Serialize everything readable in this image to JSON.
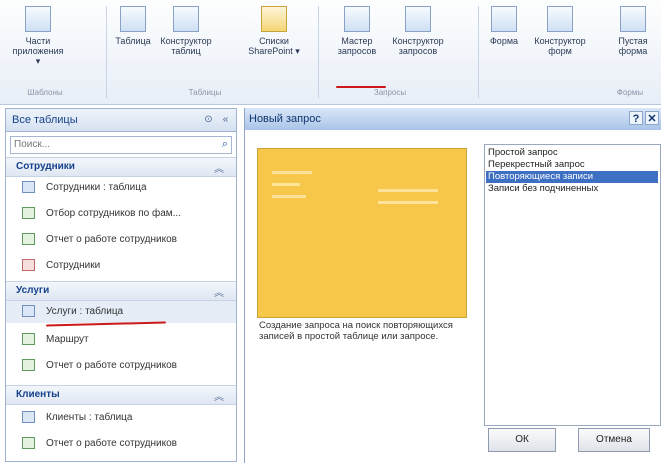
{
  "ribbon": {
    "buttons": [
      {
        "label1": "Части",
        "label2": "приложения ▾",
        "icon": "app-parts-icon"
      },
      {
        "label1": "Таблица",
        "label2": "",
        "icon": "table-icon"
      },
      {
        "label1": "Конструктор",
        "label2": "таблиц",
        "icon": "table-design-icon"
      },
      {
        "label1": "Списки",
        "label2": "SharePoint ▾",
        "icon": "sharepoint-list-icon"
      },
      {
        "label1": "Мастер",
        "label2": "запросов",
        "icon": "query-wizard-icon"
      },
      {
        "label1": "Конструктор",
        "label2": "запросов",
        "icon": "query-design-icon"
      },
      {
        "label1": "Форма",
        "label2": "",
        "icon": "form-icon"
      },
      {
        "label1": "Конструктор",
        "label2": "форм",
        "icon": "form-design-icon"
      },
      {
        "label1": "Пустая",
        "label2": "форма",
        "icon": "blank-form-icon"
      }
    ],
    "groups": [
      "Шаблоны",
      "Таблицы",
      "Запросы",
      "Формы"
    ]
  },
  "nav": {
    "title": "Все таблицы",
    "search_placeholder": "Поиск...",
    "sections": [
      {
        "title": "Сотрудники",
        "items": [
          {
            "label": "Сотрудники : таблица",
            "type": "table"
          },
          {
            "label": "Отбор сотрудников по фам...",
            "type": "query"
          },
          {
            "label": "Отчет о работе сотрудников",
            "type": "query"
          },
          {
            "label": "Сотрудники",
            "type": "form"
          }
        ]
      },
      {
        "title": "Услуги",
        "items": [
          {
            "label": "Услуги : таблица",
            "type": "table"
          },
          {
            "label": "Маршрут",
            "type": "query"
          },
          {
            "label": "Отчет о работе сотрудников",
            "type": "query"
          }
        ]
      },
      {
        "title": "Клиенты",
        "items": [
          {
            "label": "Клиенты : таблица",
            "type": "table"
          },
          {
            "label": "Отчет о работе сотрудников",
            "type": "query"
          }
        ]
      }
    ]
  },
  "dialog": {
    "title": "Новый запрос",
    "help": "?",
    "close": "✕",
    "description": "Создание запроса на поиск повторяющихся записей в простой таблице или запросе.",
    "options": [
      "Простой запрос",
      "Перекрестный запрос",
      "Повторяющиеся записи",
      "Записи без подчиненных"
    ],
    "selected_index": 2,
    "ok": "ОК",
    "cancel": "Отмена"
  },
  "colors": {
    "accent": "#3d6fc2",
    "preview": "#f7c74a",
    "annotation": "#cc1a1a"
  }
}
